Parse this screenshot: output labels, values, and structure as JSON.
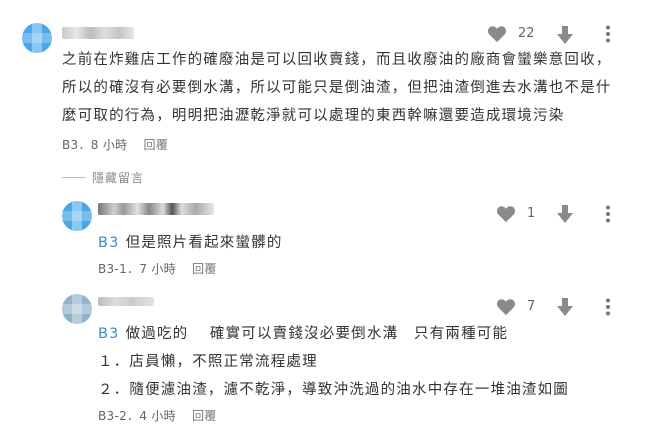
{
  "comments": [
    {
      "id": "B3",
      "likes": "22",
      "lines": [
        "之前在炸雞店工作的確廢油是可以回收賣錢，而且收廢油的廠商會蠻樂意回收，",
        "所以的確沒有必要倒水溝，所以可能只是倒油渣，但把油渣倒進去水溝也不是什",
        "麼可取的行為，明明把油瀝乾淨就可以處理的東西幹嘛還要造成環境污染"
      ],
      "meta": "B3．8 小時",
      "reply_label": "回覆"
    }
  ],
  "hide_label": "隱藏留言",
  "replies": [
    {
      "id": "B3-1",
      "likes": "1",
      "tag": "B3",
      "text": "但是照片看起來蠻髒的",
      "meta": "B3-1．7 小時",
      "reply_label": "回覆"
    },
    {
      "id": "B3-2",
      "likes": "7",
      "tag": "B3",
      "text": "做過吃的　 確實可以賣錢沒必要倒水溝　只有兩種可能",
      "list": [
        "１．店員懶，不照正常流程處理",
        "２．隨便濾油渣，濾不乾淨，導致沖洗過的油水中存在一堆油渣如圖"
      ],
      "meta": "B3-2．4 小時",
      "reply_label": "回覆"
    }
  ],
  "colors": {
    "tag": "#3b8ad9",
    "icon": "#8a8a8a"
  }
}
